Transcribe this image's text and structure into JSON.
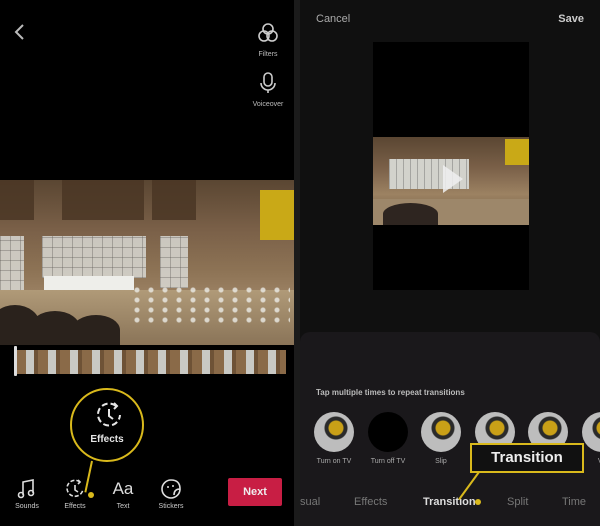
{
  "left_screen": {
    "back_icon": "chevron-left-icon",
    "side_tools": [
      {
        "label": "Filters",
        "icon": "filters-icon"
      },
      {
        "label": "Voiceover",
        "icon": "microphone-icon"
      }
    ],
    "callout": {
      "label": "Effects",
      "icon": "effects-icon",
      "color": "#d9b91c"
    },
    "bottom_tools": [
      {
        "label": "Sounds",
        "icon": "music-note-icon"
      },
      {
        "label": "Effects",
        "icon": "effects-icon"
      },
      {
        "label": "Text",
        "icon": "text-icon",
        "glyph": "Aa"
      },
      {
        "label": "Stickers",
        "icon": "sticker-icon"
      }
    ],
    "next_button": {
      "label": "Next",
      "color": "#c81e44"
    }
  },
  "right_screen": {
    "header": {
      "cancel": "Cancel",
      "save": "Save"
    },
    "hint": "Tap multiple times to repeat transitions",
    "effects": [
      {
        "label": "Turn on TV"
      },
      {
        "label": "Turn off TV"
      },
      {
        "label": "Slip"
      },
      {
        "label": ""
      },
      {
        "label": ""
      },
      {
        "label": "Ve"
      }
    ],
    "tabs": [
      {
        "label": "sual",
        "active": false
      },
      {
        "label": "Effects",
        "active": false
      },
      {
        "label": "Transition",
        "active": true
      },
      {
        "label": "Split",
        "active": false
      },
      {
        "label": "Time",
        "active": false
      }
    ],
    "callout": {
      "label": "Transition",
      "color": "#d9b91c"
    }
  }
}
